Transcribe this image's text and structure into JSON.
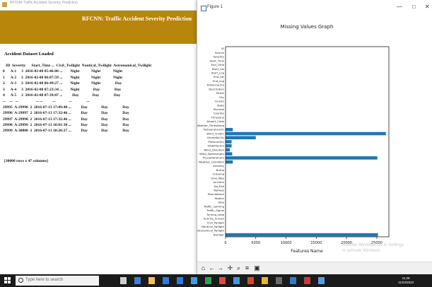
{
  "tk_window": {
    "title": "RFCNN Traffic Accident Severity Prediction",
    "banner_title": "RFCNN: Traffic Accident Severity Prediction",
    "dataset_label": "Accident Dataset Loaded",
    "table_header": "   ID  Severity      Start_Time ...  Civil_Twilight  Nautical_Twilight  Astronomical_Twilight",
    "table_rows": [
      "0      A-1     3  2016-02-08 05:46:00 ...        Night            Night             Night",
      "1      A-2     2  2016-02-08 06:07:59 ...        Night            Night             Night",
      "2      A-3     2  2016-02-08 06:49:27 ...        Night            Night               Day",
      "3      A-4     3  2016-02-08 07:23:34 ...        Night              Day               Day",
      "4      A-5     2  2016-02-08 07:39:07 ...          Day              Day               Day",
      "...    ...   ...                  ... ...          ...              ...               ...",
      "29995  A-29996  2  2016-07-13 17:09:48 ...          Day              Day               Day",
      "29996  A-29997  2  2016-07-13 17:32:46 ...          Day              Day               Day",
      "29997  A-29998  2  2016-07-13 17:32:46 ...          Day              Day               Day",
      "29998  A-29999  2  2016-07-13 18:01:30 ...          Day              Day               Day",
      "29999  A-30000  2  2016-07-13 18:26:27 ...          Day              Day               Day"
    ],
    "shape_text": "[30000 rows x 47 columns]"
  },
  "figure_window": {
    "title": "Figure 1",
    "minimize": "—",
    "maximize": "□",
    "close": "✕",
    "watermark": "Activate Windows  Go to Settings to activate Windows."
  },
  "toolbar": {
    "home_icon": "⌂",
    "back_icon": "←",
    "forward_icon": "→",
    "pan_icon": "✛",
    "zoom_icon": "⌕",
    "configure_icon": "≡",
    "save_icon": "▣"
  },
  "taskbar": {
    "search_placeholder": "Type here to search",
    "clock_time": "11:28",
    "clock_date": "11/23/2023"
  },
  "chart_data": {
    "type": "bar",
    "orientation": "horizontal",
    "title": "Missing Values Graph",
    "xlabel": "Features Name",
    "ylabel": "",
    "xlim": [
      0,
      27000
    ],
    "xticks": [
      0,
      5000,
      10000,
      15000,
      20000,
      25000
    ],
    "grid": false,
    "color": "#1f77b4",
    "categories": [
      "ID",
      "Source",
      "Severity",
      "Start_Time",
      "End_Time",
      "Start_Lat",
      "Start_Lng",
      "End_Lat",
      "End_Lng",
      "Distance(mi)",
      "Description",
      "Street",
      "City",
      "County",
      "State",
      "Zipcode",
      "Country",
      "Timezone",
      "Airport_Code",
      "Weather_Timestamp",
      "Temperature(F)",
      "Wind_Chill(F)",
      "Humidity(%)",
      "Pressure(in)",
      "Visibility(mi)",
      "Wind_Direction",
      "Wind_Speed(mph)",
      "Precipitation(in)",
      "Weather_Condition",
      "Amenity",
      "Bump",
      "Crossing",
      "Give_Way",
      "Junction",
      "No_Exit",
      "Railway",
      "Roundabout",
      "Station",
      "Stop",
      "Traffic_Calming",
      "Traffic_Signal",
      "Turning_Loop",
      "Sunrise_Sunset",
      "Civil_Twilight",
      "Nautical_Twilight",
      "Astronomical_Twilight",
      "Number"
    ],
    "values": [
      0,
      0,
      0,
      0,
      0,
      0,
      0,
      0,
      0,
      0,
      0,
      0,
      0,
      0,
      0,
      0,
      0,
      0,
      0,
      0,
      1200,
      26500,
      5000,
      1000,
      1000,
      700,
      1100,
      25100,
      1200,
      0,
      0,
      0,
      0,
      0,
      0,
      0,
      0,
      0,
      0,
      0,
      0,
      0,
      0,
      0,
      0,
      0,
      25200
    ]
  }
}
